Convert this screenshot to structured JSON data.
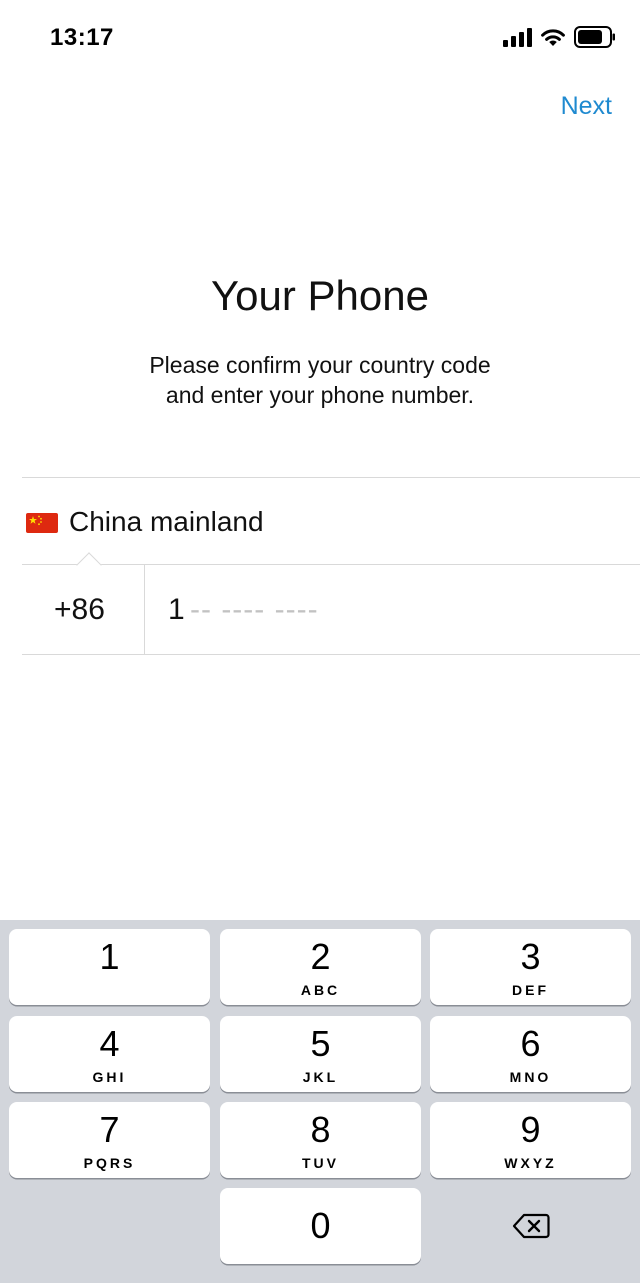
{
  "status_bar": {
    "time": "13:17",
    "icons": [
      "cellular-signal-icon",
      "wifi-icon",
      "battery-icon"
    ]
  },
  "nav": {
    "next_label": "Next",
    "accent_color": "#1f8ad0"
  },
  "header": {
    "title": "Your Phone",
    "subtitle_line1": "Please confirm your country code",
    "subtitle_line2": "and enter your phone number."
  },
  "country": {
    "flag_icon": "china-flag-icon",
    "name": "China mainland"
  },
  "phone": {
    "country_code": "+86",
    "number_value": "1",
    "number_placeholder": "-- ---- ----"
  },
  "keypad": {
    "keys": [
      {
        "digit": "1",
        "letters": ""
      },
      {
        "digit": "2",
        "letters": "ABC"
      },
      {
        "digit": "3",
        "letters": "DEF"
      },
      {
        "digit": "4",
        "letters": "GHI"
      },
      {
        "digit": "5",
        "letters": "JKL"
      },
      {
        "digit": "6",
        "letters": "MNO"
      },
      {
        "digit": "7",
        "letters": "PQRS"
      },
      {
        "digit": "8",
        "letters": "TUV"
      },
      {
        "digit": "9",
        "letters": "WXYZ"
      },
      {
        "digit": "0",
        "letters": ""
      }
    ],
    "backspace_icon": "backspace-icon"
  }
}
